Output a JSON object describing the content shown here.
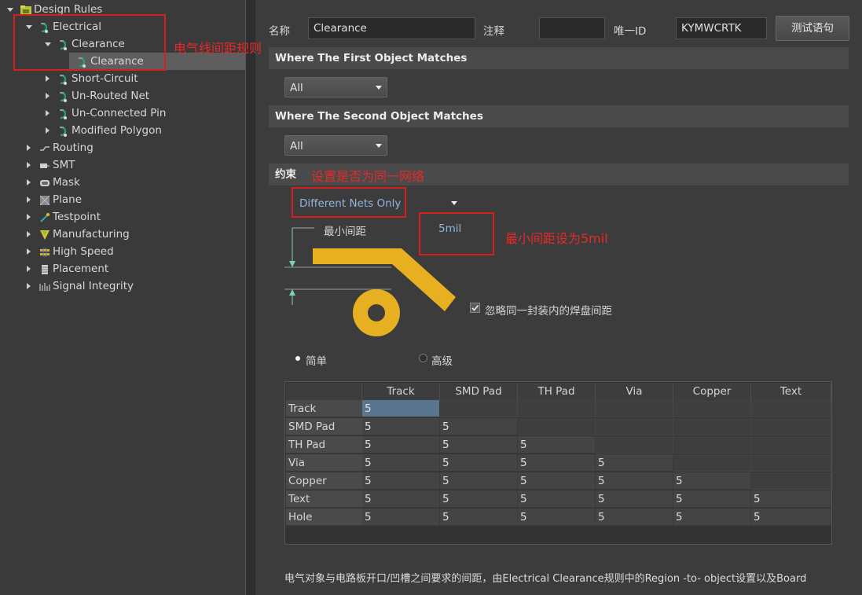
{
  "tree": {
    "items": [
      {
        "label": "Design Rules",
        "indent": 0,
        "expanded": true,
        "icon": "design-rules-folder-icon"
      },
      {
        "label": "Electrical",
        "indent": 1,
        "expanded": true,
        "icon": "rule-icon"
      },
      {
        "label": "Clearance",
        "indent": 2,
        "expanded": true,
        "icon": "rule-icon"
      },
      {
        "label": "Clearance",
        "indent": 3,
        "selected": true,
        "icon": "rule-icon"
      },
      {
        "label": "Short-Circuit",
        "indent": 2,
        "expanded": false,
        "icon": "rule-icon"
      },
      {
        "label": "Un-Routed Net",
        "indent": 2,
        "expanded": false,
        "icon": "rule-icon"
      },
      {
        "label": "Un-Connected Pin",
        "indent": 2,
        "expanded": false,
        "icon": "rule-icon"
      },
      {
        "label": "Modified Polygon",
        "indent": 2,
        "expanded": false,
        "icon": "rule-icon"
      },
      {
        "label": "Routing",
        "indent": 1,
        "expanded": false,
        "icon": "routing-icon"
      },
      {
        "label": "SMT",
        "indent": 1,
        "expanded": false,
        "icon": "smt-icon"
      },
      {
        "label": "Mask",
        "indent": 1,
        "expanded": false,
        "icon": "mask-icon"
      },
      {
        "label": "Plane",
        "indent": 1,
        "expanded": false,
        "icon": "plane-icon"
      },
      {
        "label": "Testpoint",
        "indent": 1,
        "expanded": false,
        "icon": "testpoint-icon"
      },
      {
        "label": "Manufacturing",
        "indent": 1,
        "expanded": false,
        "icon": "manufacturing-icon"
      },
      {
        "label": "High Speed",
        "indent": 1,
        "expanded": false,
        "icon": "high-speed-icon"
      },
      {
        "label": "Placement",
        "indent": 1,
        "expanded": false,
        "icon": "placement-icon"
      },
      {
        "label": "Signal Integrity",
        "indent": 1,
        "expanded": false,
        "icon": "signal-integrity-icon"
      }
    ]
  },
  "header": {
    "name_label": "名称",
    "name_value": "Clearance",
    "comment_label": "注释",
    "comment_value": "",
    "uid_label": "唯一ID",
    "uid_value": "KYMWCRTK",
    "test_button": "测试语句"
  },
  "first_match": {
    "title": "Where The First Object Matches",
    "combo": "All"
  },
  "second_match": {
    "title": "Where The Second Object Matches",
    "combo": "All"
  },
  "constraints": {
    "title": "约束",
    "net_scope": "Different Nets Only",
    "min_clearance_label": "最小间距",
    "min_clearance_value": "5mil",
    "ignore_pads_label": "忽略同一封装内的焊盘间距",
    "ignore_pads_checked": true,
    "mode_simple": "简单",
    "mode_advanced": "高级",
    "mode_selected": "simple"
  },
  "annotations": {
    "electrical_rule": "电气线间距规则",
    "same_net": "设置是否为同一网络",
    "min_spacing": "最小间距设为5mil"
  },
  "grid": {
    "columns": [
      "Track",
      "SMD Pad",
      "TH Pad",
      "Via",
      "Copper",
      "Text"
    ],
    "rows": [
      {
        "label": "Track",
        "values": [
          "5"
        ]
      },
      {
        "label": "SMD Pad",
        "values": [
          "5",
          "5"
        ]
      },
      {
        "label": "TH Pad",
        "values": [
          "5",
          "5",
          "5"
        ]
      },
      {
        "label": "Via",
        "values": [
          "5",
          "5",
          "5",
          "5"
        ]
      },
      {
        "label": "Copper",
        "values": [
          "5",
          "5",
          "5",
          "5",
          "5"
        ]
      },
      {
        "label": "Text",
        "values": [
          "5",
          "5",
          "5",
          "5",
          "5",
          "5"
        ]
      },
      {
        "label": "Hole",
        "values": [
          "5",
          "5",
          "5",
          "5",
          "5",
          "5"
        ]
      }
    ]
  },
  "footer_text": "电气对象与电路板开口/凹槽之间要求的间距，由Electrical Clearance规则中的Region -to- object设置以及Board",
  "colors": {
    "accent_red": "#e8282a",
    "copper": "#e6b020",
    "selected_cell": "#5a7590"
  }
}
